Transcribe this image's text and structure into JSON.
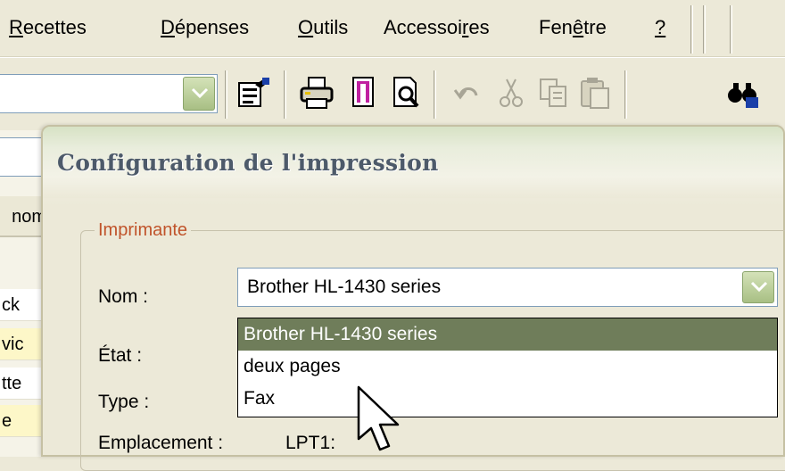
{
  "menubar": {
    "items": [
      {
        "label": "Recettes",
        "accel_index": 0
      },
      {
        "label": "Dépenses",
        "accel_index": 0
      },
      {
        "label": "Outils",
        "accel_index": 0
      },
      {
        "label": "Accessoires",
        "accel_index": 8
      },
      {
        "label": "Fenêtre",
        "accel_index": 3
      },
      {
        "label": "?",
        "accel_index": 0
      }
    ]
  },
  "toolbar": {
    "combo_value": "",
    "icons": [
      "properties-icon",
      "print-icon",
      "page-icon",
      "print-preview-icon",
      "undo-icon",
      "cut-icon",
      "copy-icon",
      "paste-icon",
      "find-icon"
    ]
  },
  "left_pane": {
    "search_value": "",
    "header_text": "nom",
    "rows": [
      "ck",
      "vic",
      "tte",
      "e"
    ]
  },
  "dialog": {
    "title": "Configuration de l'impression",
    "group_label": "Imprimante",
    "name_label": "Nom :",
    "state_label": "État :",
    "type_label": "Type :",
    "location_label": "Emplacement :",
    "location_value": "LPT1:",
    "printer_selected": "Brother HL-1430 series",
    "printer_options": [
      "Brother HL-1430 series",
      "deux pages",
      "Fax"
    ],
    "highlighted_option_index": 0
  },
  "colors": {
    "highlight": "#6f7d5a",
    "group_label": "#c0532a",
    "title_text": "#4d5a6a"
  }
}
